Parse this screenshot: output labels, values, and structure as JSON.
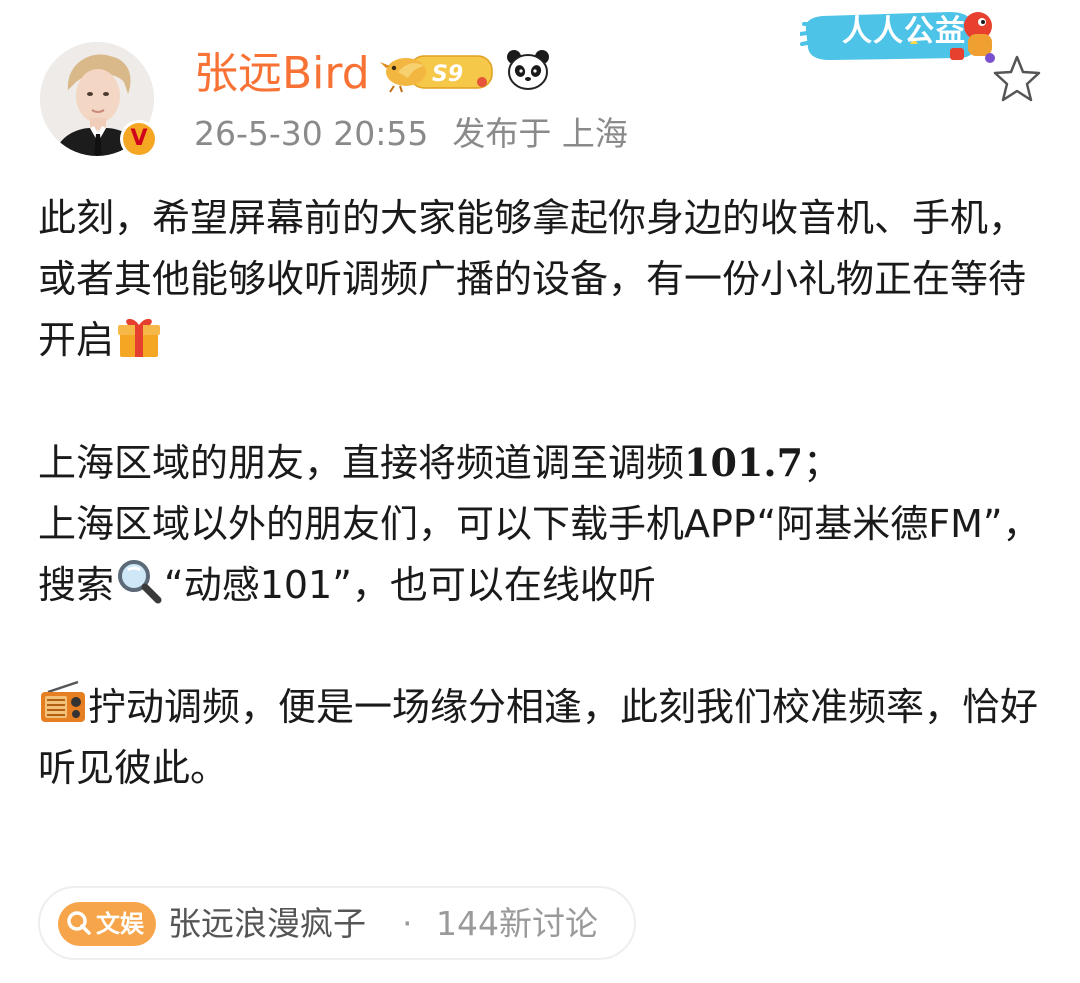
{
  "post": {
    "author": {
      "name": "张远Bird",
      "verified_mark": "V",
      "level_badge": "S9",
      "avatar": "portrait-avatar",
      "extra_icon": "panda-icon"
    },
    "meta": {
      "time": "26-5-30 20:55",
      "location": "发布于 上海"
    },
    "campaign_badge": "人人公益",
    "favorite_icon": "star-outline-icon",
    "body": {
      "p1_text": "此刻，希望屏幕前的大家能够拿起你身边的收音机、手机，或者其他能够收听调频广播的设备，有一份小礼物正在等待开启",
      "p1_emoji": "gift-emoji",
      "p2_line1_prefix": "上海区域的朋友，直接将频道调至调频",
      "p2_line1_number": "101.7",
      "p2_line1_suffix": "；",
      "p2_line2_a": "上海区域以外的朋友们，可以下载手机APP“阿基米德FM”，搜索",
      "p2_line2_emoji": "magnifier-emoji",
      "p2_line2_b": "“动感101”，也可以在线收听",
      "p3_emoji": "radio-emoji",
      "p3_text": "拧动调频，便是一场缘分相逢，此刻我们校准频率，恰好听见彼此。"
    },
    "topic": {
      "tag_label": "文娱",
      "name": "张远浪漫疯子",
      "separator": "·",
      "count": "144新讨论"
    }
  },
  "colors": {
    "username": "#f77234",
    "meta": "#8a8a8a",
    "body_text": "#1a1a1a",
    "topic_tag_bg": "#f7a54a",
    "verified_bg": "#f5a623"
  }
}
